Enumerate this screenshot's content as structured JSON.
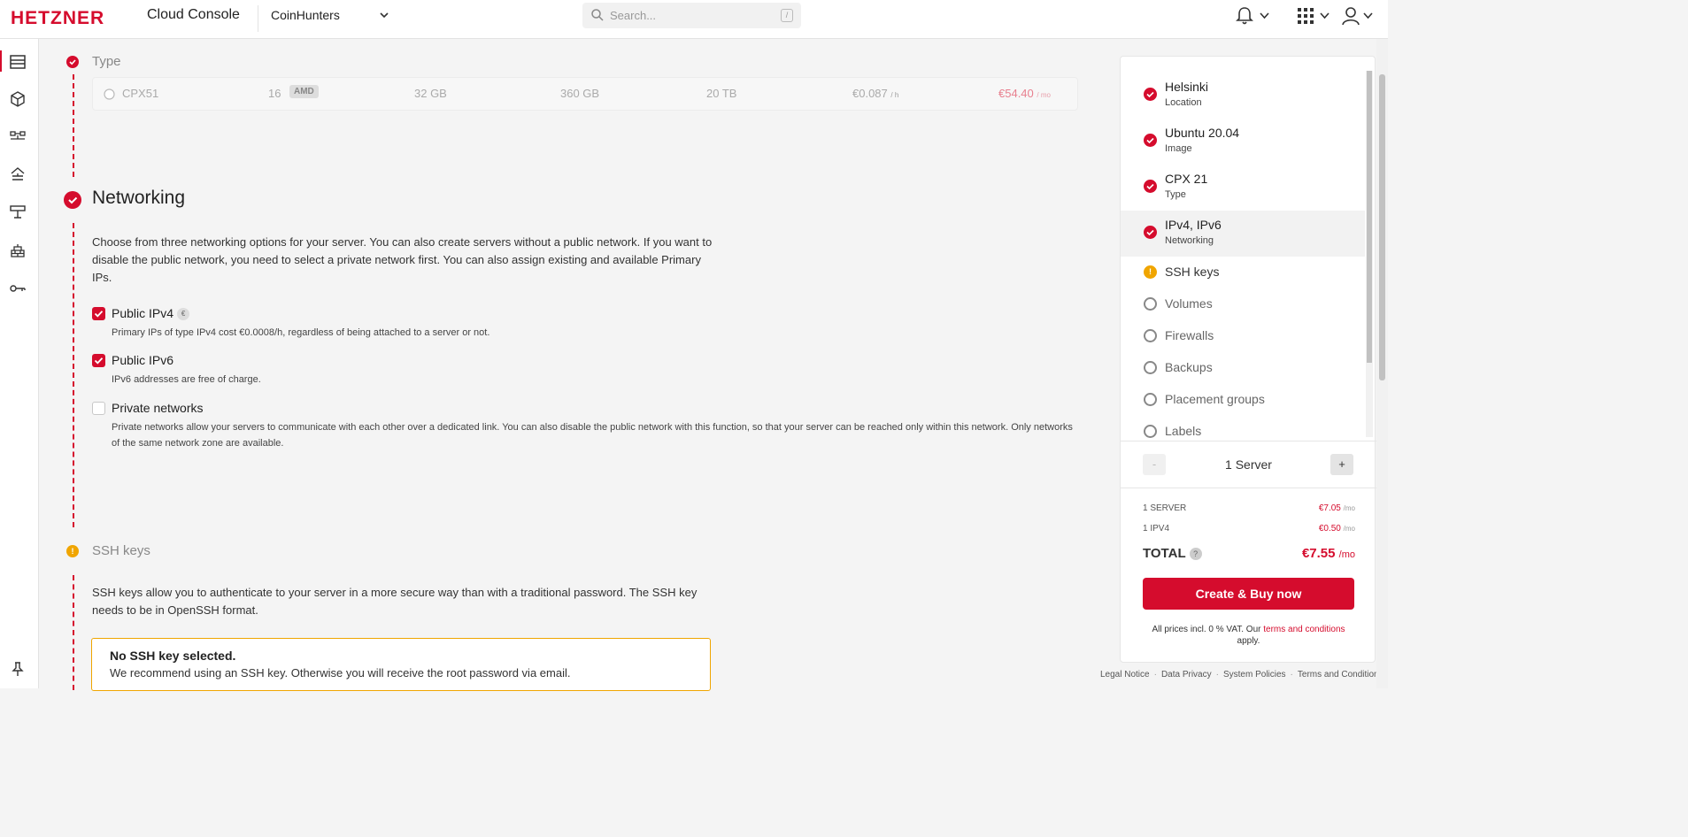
{
  "header": {
    "logo": "HETZNER",
    "console_title": "Cloud Console",
    "project": "CoinHunters",
    "search_placeholder": "Search...",
    "search_shortcut": "/"
  },
  "type_section": {
    "title": "Type",
    "row": {
      "name": "CPX51",
      "vcpu": "16",
      "cpu_badge": "AMD",
      "ram": "32 GB",
      "disk": "360 GB",
      "traffic": "20 TB",
      "price_hourly": "€0.087",
      "hourly_unit": "/ h",
      "price_monthly": "€54.40",
      "monthly_unit": "/ mo"
    }
  },
  "networking": {
    "title": "Networking",
    "description": "Choose from three networking options for your server. You can also create servers without a public network. If you want to disable the public network, you need to select a private network first. You can also assign existing and available Primary IPs.",
    "ipv4_label": "Public IPv4",
    "ipv4_badge": "€",
    "ipv4_desc": "Primary IPs of type IPv4 cost €0.0008/h, regardless of being attached to a server or not.",
    "ipv6_label": "Public IPv6",
    "ipv6_desc": "IPv6 addresses are free of charge.",
    "private_label": "Private networks",
    "private_desc": "Private networks allow your servers to communicate with each other over a dedicated link. You can also disable the public network with this function, so that your server can be reached only within this network. Only networks of the same network zone are available."
  },
  "ssh": {
    "title": "SSH keys",
    "status_mark": "!",
    "description": "SSH keys allow you to authenticate to your server in a more secure way than with a traditional password. The SSH key needs to be in OpenSSH format.",
    "alert_title": "No SSH key selected.",
    "alert_text": "We recommend using an SSH key. Otherwise you will receive the root password via email."
  },
  "summary": {
    "items": [
      {
        "title": "Helsinki",
        "sub": "Location"
      },
      {
        "title": "Ubuntu 20.04",
        "sub": "Image"
      },
      {
        "title": "CPX 21",
        "sub": "Type"
      },
      {
        "title": "IPv4, IPv6",
        "sub": "Networking"
      },
      {
        "title": "SSH keys"
      },
      {
        "title": "Volumes"
      },
      {
        "title": "Firewalls"
      },
      {
        "title": "Backups"
      },
      {
        "title": "Placement groups"
      },
      {
        "title": "Labels"
      }
    ],
    "warn_mark": "!",
    "minus": "-",
    "plus": "+",
    "server_count": "1 Server",
    "line1_label": "1 SERVER",
    "line1_value": "€7.05",
    "line2_label": "1 IPV4",
    "line2_value": "€0.50",
    "per_mo": "/mo",
    "total_label": "TOTAL",
    "total_help": "?",
    "total_value": "€7.55",
    "buy_label": "Create & Buy now",
    "vat_text": "All prices incl. 0 % VAT. Our",
    "terms_link": "terms and conditions",
    "vat_apply": "apply."
  },
  "footer": {
    "legal": "Legal Notice",
    "privacy": "Data Privacy",
    "policies": "System Policies",
    "terms": "Terms and Conditions",
    "sep": "·"
  },
  "colors": {
    "brand_red": "#d50c2d",
    "warning": "#f0a500"
  }
}
